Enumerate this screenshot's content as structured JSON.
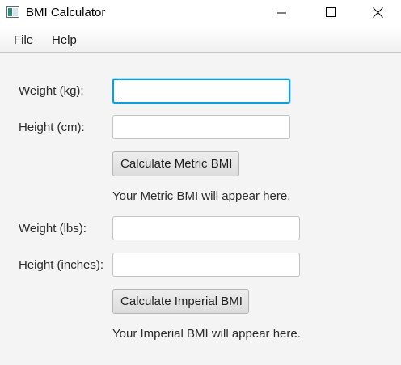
{
  "window": {
    "title": "BMI Calculator",
    "icon": "app-window-icon",
    "controls": [
      "minimize-icon",
      "maximize-icon",
      "close-icon"
    ]
  },
  "menu": {
    "items": [
      {
        "label": "File"
      },
      {
        "label": "Help"
      }
    ]
  },
  "metric": {
    "weight_label": "Weight (kg):",
    "weight_value": "",
    "height_label": "Height (cm):",
    "height_value": "",
    "button_label": "Calculate Metric BMI",
    "result_text": "Your Metric BMI will appear here."
  },
  "imperial": {
    "weight_label": "Weight (lbs):",
    "weight_value": "",
    "height_label": "Height (inches):",
    "height_value": "",
    "button_label": "Calculate Imperial BMI",
    "result_text": "Your Imperial BMI will appear here."
  },
  "colors": {
    "focus_border": "#0f9fd8",
    "background": "#f4f4f4"
  }
}
